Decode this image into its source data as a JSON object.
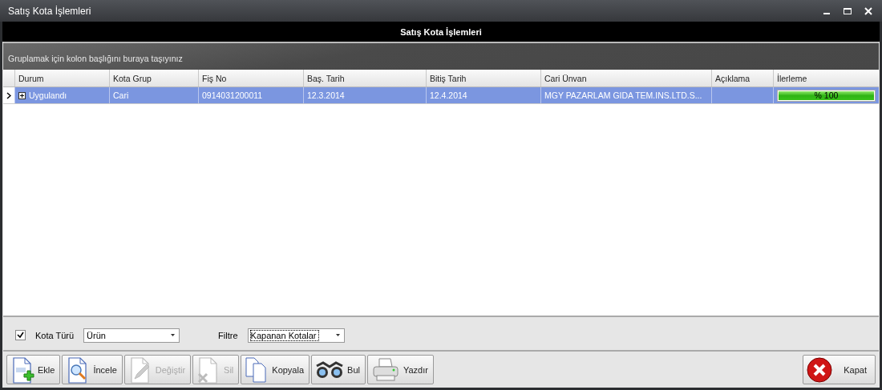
{
  "window": {
    "title": "Satış Kota İşlemleri"
  },
  "header": {
    "title": "Satış Kota İşlemleri"
  },
  "group_panel": {
    "text": "Gruplamak için kolon başlığını buraya taşıyınız"
  },
  "table": {
    "columns": [
      "Durum",
      "Kota Grup",
      "Fiş No",
      "Baş. Tarih",
      "Bitiş Tarih",
      "Cari Ünvan",
      "Açıklama",
      "İlerleme"
    ],
    "rows": [
      {
        "selected": true,
        "expanded": false,
        "cells": [
          "Uygulandı",
          "Cari",
          "0914031200011",
          "12.3.2014",
          "12.4.2014",
          "MGY PAZARLAM GIDA TEM.INS.LTD.S...",
          ""
        ],
        "progress": {
          "level": 1,
          "text": "% 100"
        }
      }
    ]
  },
  "filters": {
    "kota_turu": {
      "label": "Kota Türü",
      "checked": true,
      "value": "Ürün"
    },
    "filtre": {
      "label": "Filtre",
      "value": "Kapanan Kotalar",
      "focused": true
    }
  },
  "buttons": [
    {
      "kind": "add",
      "label": "Ekle",
      "disabled": false
    },
    {
      "kind": "view",
      "label": "İncele",
      "disabled": false
    },
    {
      "kind": "edit",
      "label": "Değiştir",
      "disabled": true
    },
    {
      "kind": "delete",
      "label": "Sil",
      "disabled": true
    },
    {
      "kind": "copy",
      "label": "Kopyala",
      "disabled": false
    },
    {
      "kind": "find",
      "label": "Bul",
      "disabled": false
    },
    {
      "kind": "print",
      "label": "Yazdır",
      "disabled": false
    }
  ],
  "close_button": {
    "label": "Kapat"
  }
}
